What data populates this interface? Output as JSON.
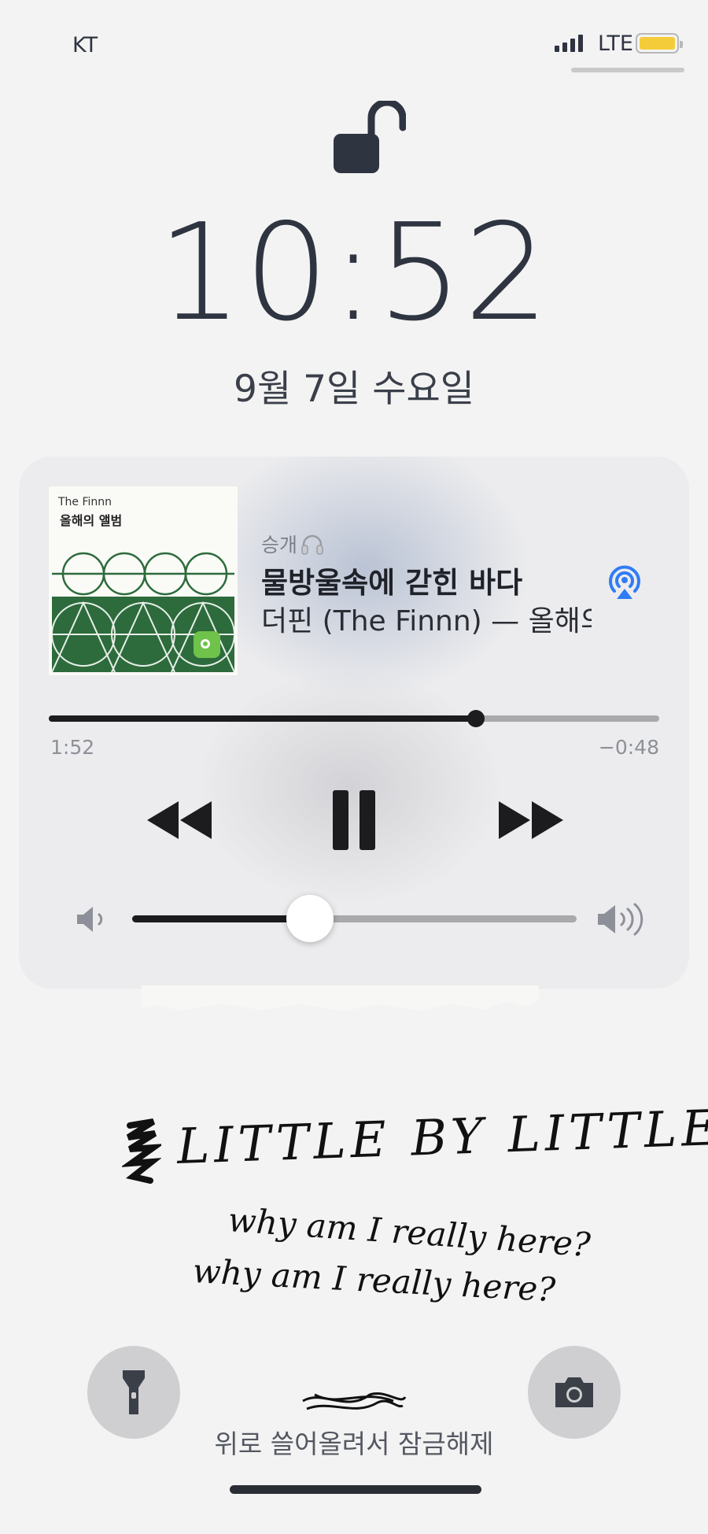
{
  "status_bar": {
    "carrier": "KT",
    "network": "LTE",
    "signal_bars": 4,
    "battery_color": "#f4cc3a"
  },
  "lock_screen": {
    "lock_icon": "unlocked-padlock-icon",
    "time": "10:52",
    "date": "9월 7일 수요일"
  },
  "now_playing": {
    "album_art": {
      "artist": "The Finnn",
      "title": "올해의 앨범"
    },
    "device": "승개",
    "device_icon": "headphones-icon",
    "song_title": "물방울속에 갇힌 바다",
    "artist_album": "더핀 (The Finnn) — 올해의 앨범",
    "airplay_icon": "airplay-icon",
    "airplay_color": "#2f7cf6",
    "progress": {
      "elapsed": "1:52",
      "remaining": "−0:48",
      "fraction": 0.7
    },
    "controls": {
      "rewind": "rewind-icon",
      "pause": "pause-icon",
      "forward": "fast-forward-icon"
    },
    "volume": {
      "fraction": 0.4,
      "low_icon": "speaker-low-icon",
      "high_icon": "speaker-high-icon"
    }
  },
  "wallpaper": {
    "handwriting_line1": "LITTLE BY LITTLE",
    "handwriting_line2": "why am I really here?",
    "handwriting_line3": "why am I really here?"
  },
  "bottom": {
    "flashlight_icon": "flashlight-icon",
    "camera_icon": "camera-icon",
    "unlock_hint": "위로 쓸어올려서 잠금해제"
  }
}
